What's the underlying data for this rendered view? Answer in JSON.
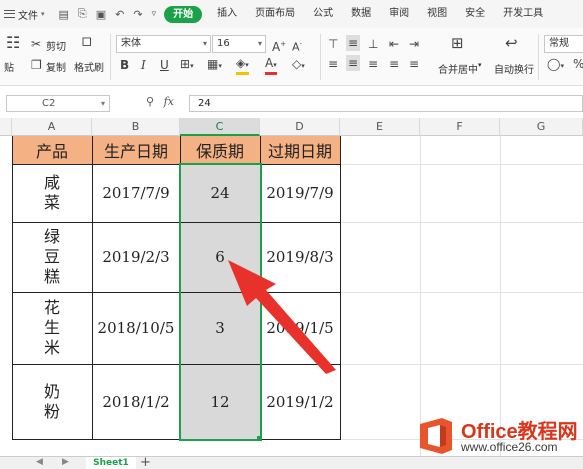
{
  "menu": {
    "file_label": "文件",
    "tabs": [
      "开始",
      "插入",
      "页面布局",
      "公式",
      "数据",
      "审阅",
      "视图",
      "安全",
      "开发工具"
    ]
  },
  "ribbon": {
    "cut_label": "剪切",
    "copy_label": "复制",
    "paste_label": "贴",
    "format_painter_label": "格式刷",
    "font_name": "宋体",
    "font_size": "16",
    "merge_center_label": "合并居中",
    "wrap_text_label": "自动换行",
    "number_format": "常规"
  },
  "formula_bar": {
    "cell_ref": "C2",
    "fx_label": "fx",
    "value": "24"
  },
  "columns": [
    "A",
    "B",
    "C",
    "D",
    "E",
    "F",
    "G"
  ],
  "table": {
    "headers": [
      "产品",
      "生产日期",
      "保质期",
      "过期日期"
    ],
    "rows": [
      {
        "product": "咸\n菜",
        "prod_date": "2017/7/9",
        "shelf_life": "24",
        "exp_date": "2019/7/9"
      },
      {
        "product": "绿\n豆\n糕",
        "prod_date": "2019/2/3",
        "shelf_life": "6",
        "exp_date": "2019/8/3"
      },
      {
        "product": "花\n生\n米",
        "prod_date": "2018/10/5",
        "shelf_life": "3",
        "exp_date": "2019/1/5"
      },
      {
        "product": "奶\n粉",
        "prod_date": "2018/1/2",
        "shelf_life": "12",
        "exp_date": "2019/1/2"
      }
    ]
  },
  "sheet": {
    "tab_label": "Sheet1",
    "add_label": "+"
  },
  "watermark": {
    "brand": "Office教程网",
    "url": "www.office26.com"
  },
  "colors": {
    "accent_green": "#1aa14a",
    "header_fill": "#f4b183",
    "arrow_red": "#e8312a",
    "selected_column": "#d9d9d9"
  }
}
